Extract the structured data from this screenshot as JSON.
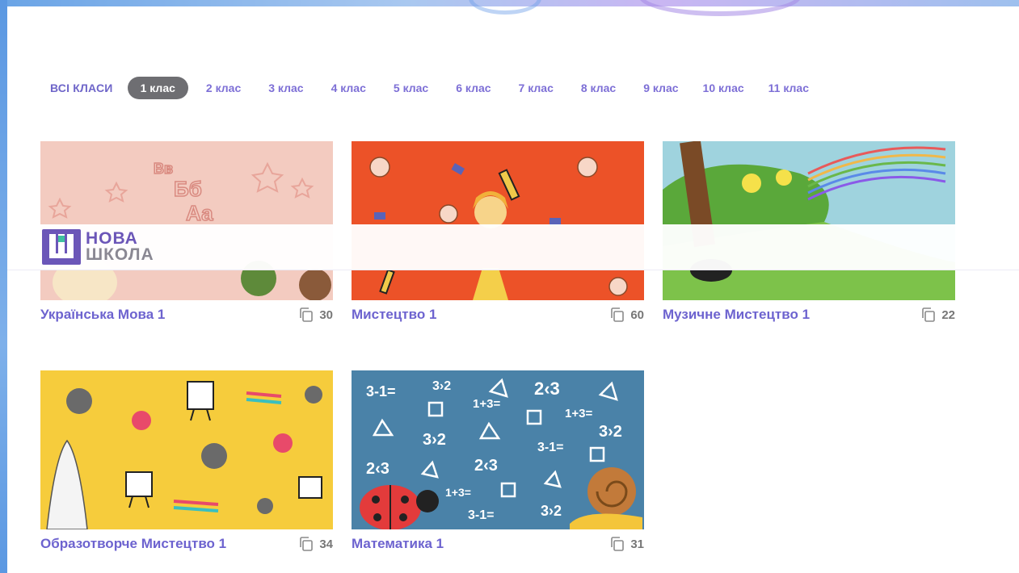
{
  "tabs": [
    {
      "label": "ВСІ КЛАСИ",
      "active": false
    },
    {
      "label": "1 клас",
      "active": true
    },
    {
      "label": "2 клас",
      "active": false
    },
    {
      "label": "3 клас",
      "active": false
    },
    {
      "label": "4 клас",
      "active": false
    },
    {
      "label": "5 клас",
      "active": false
    },
    {
      "label": "6 клас",
      "active": false
    },
    {
      "label": "7 клас",
      "active": false
    },
    {
      "label": "8 клас",
      "active": false
    },
    {
      "label": "9 клас",
      "active": false
    },
    {
      "label": "10 клас",
      "active": false
    },
    {
      "label": "11 клас",
      "active": false
    }
  ],
  "logo": {
    "line1": "НОВА",
    "line2": "ШКОЛА"
  },
  "cards": [
    {
      "title": "Українська Мова 1",
      "count": "30",
      "cover_color": "#f3cbc0"
    },
    {
      "title": "Мистецтво 1",
      "count": "60",
      "cover_color": "#ec5228"
    },
    {
      "title": "Музичне Мистецтво 1",
      "count": "22",
      "cover_color": "#9fd3de"
    },
    {
      "title": "Образотворче Мистецтво 1",
      "count": "34",
      "cover_color": "#f6cc3c"
    },
    {
      "title": "Математика 1",
      "count": "31",
      "cover_color": "#4a82a8"
    }
  ],
  "math_cover": {
    "texts": [
      "3-1=",
      "3›2",
      "2‹3",
      "1+3=",
      "1+3=",
      "3›2",
      "3›2",
      "3-1=",
      "2‹3",
      "2‹3",
      "1+3=",
      "3-1=",
      "3›2"
    ]
  },
  "colors": {
    "accent": "#6d63cf",
    "active_tab": "#6e6e72"
  }
}
